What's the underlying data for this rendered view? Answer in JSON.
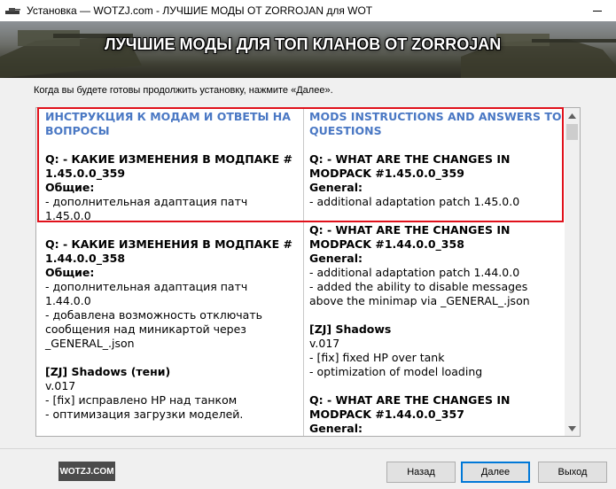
{
  "window": {
    "title": "Установка — WOTZJ.com - ЛУЧШИЕ МОДЫ ОТ ZORROJAN для WOT"
  },
  "banner": {
    "headline": "ЛУЧШИЕ МОДЫ ДЛЯ ТОП КЛАНОВ ОТ ZORROJAN"
  },
  "instruction": "Когда вы будете готовы продолжить установку, нажмите «Далее».",
  "content": {
    "left": {
      "heading_1": "ИНСТРУКЦИЯ К МОДАМ И ОТВЕТЫ НА",
      "heading_2": "ВОПРОСЫ",
      "q1_1": "Q: - КАКИЕ ИЗМЕНЕНИЯ В МОДПАКЕ #",
      "q1_2": "1.45.0.0_359",
      "g1": "Общие:",
      "l1_1": "- дополнительная адаптация патч",
      "l1_2": "1.45.0.0",
      "q2_1": "Q: - КАКИЕ ИЗМЕНЕНИЯ В МОДПАКЕ #",
      "q2_2": "1.44.0.0_358",
      "g2": "Общие:",
      "l2_1": "- дополнительная адаптация патч",
      "l2_2": "1.44.0.0",
      "l2_3": "- добавлена возможность отключать",
      "l2_4": "сообщения над миникартой через",
      "l2_5": "_GENERAL_.json",
      "s_title": "[ZJ] Shadows (тени)",
      "s_ver": "v.017",
      "s_1": "- [fix] исправлено HP над танком",
      "s_2": "- оптимизация загрузки моделей."
    },
    "right": {
      "heading_1": "MODS INSTRUCTIONS AND ANSWERS TO",
      "heading_2": "QUESTIONS",
      "q1_1": "Q: - WHAT ARE THE CHANGES IN",
      "q1_2": "MODPACK #1.45.0.0_359",
      "g1": "General:",
      "l1_1": "- additional adaptation patch 1.45.0.0",
      "q2_1": "Q: - WHAT ARE THE CHANGES IN",
      "q2_2": "MODPACK #1.44.0.0_358",
      "g2": "General:",
      "l2_1": "- additional adaptation patch 1.44.0.0",
      "l2_2": "- added the ability to disable messages",
      "l2_3": "above the minimap via _GENERAL_.json",
      "s_title": "[ZJ] Shadows",
      "s_ver": "v.017",
      "s_1": "- [fix] fixed HP over tank",
      "s_2": "- optimization of model loading",
      "q3_1": "Q: - WHAT ARE THE CHANGES IN",
      "q3_2": "MODPACK #1.44.0.0_357",
      "g3": "General:"
    }
  },
  "footer": {
    "brand": "WOTZJ.COM",
    "back": "Назад",
    "next": "Далее",
    "exit": "Выход"
  },
  "colors": {
    "heading": "#4a78c4",
    "highlight": "#e0111b",
    "focus": "#0078d7"
  }
}
